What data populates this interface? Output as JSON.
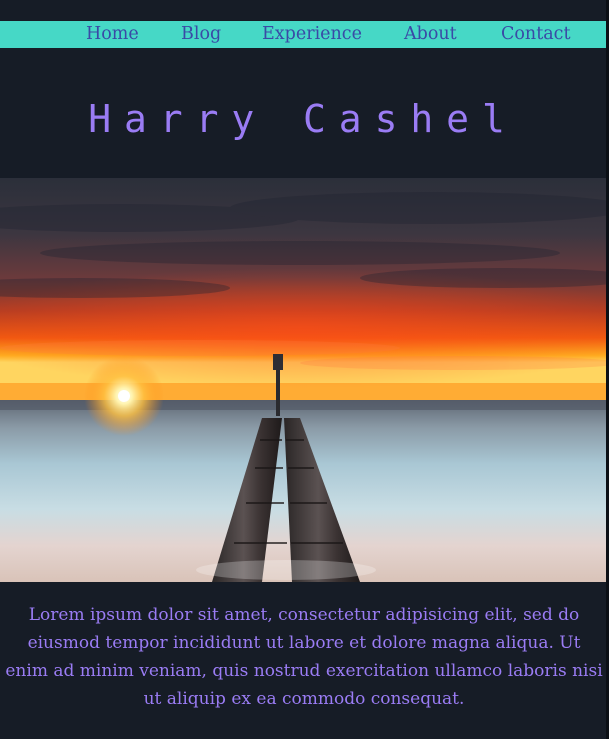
{
  "nav": {
    "items": [
      "Home",
      "Blog",
      "Experience",
      "About",
      "Contact"
    ]
  },
  "header": {
    "title": "Harry Cashel"
  },
  "hero": {
    "image_alt": "Sunset over the sea with pipes leading into the water"
  },
  "content": {
    "intro": "Lorem ipsum dolor sit amet, consectetur adipisicing elit, sed do eiusmod tempor incididunt ut labore et dolore magna aliqua. Ut enim ad minim veniam, quis nostrud exercitation ullamco laboris nisi ut aliquip ex ea commodo consequat."
  },
  "colors": {
    "background": "#161c26",
    "nav": "#46d8c6",
    "nav_text": "#3a4aa6",
    "accent": "#9a7cf4"
  }
}
